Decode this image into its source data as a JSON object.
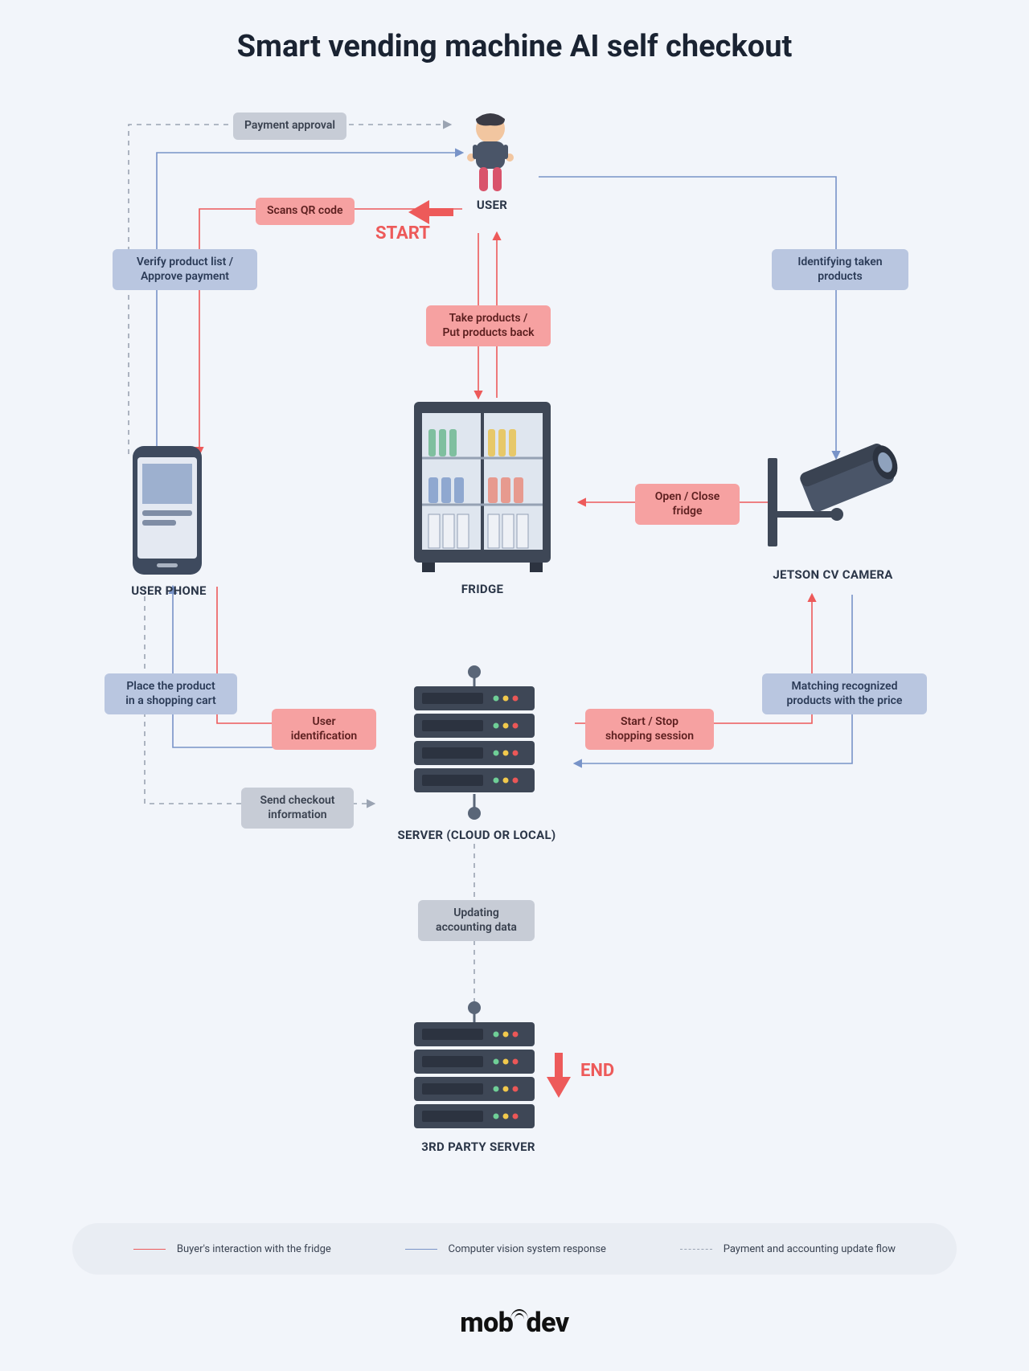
{
  "title": "Smart vending machine AI self checkout",
  "markers": {
    "start": "START",
    "end": "END"
  },
  "nodes": {
    "user": "USER",
    "phone": "USER PHONE",
    "fridge": "FRIDGE",
    "camera": "JETSON CV CAMERA",
    "server": "SERVER (CLOUD OR LOCAL)",
    "third_party": "3RD PARTY SERVER"
  },
  "edges": {
    "payment_approval": "Payment approval",
    "scans_qr": "Scans QR code",
    "verify_approve": "Verify product list /\nApprove payment",
    "identifying": "Identifying taken\nproducts",
    "take_put": "Take products /\nPut products back",
    "open_close": "Open / Close\nfridge",
    "place_cart": "Place the product\nin a shopping cart",
    "user_ident": "User\nidentification",
    "start_stop": "Start / Stop\nshopping session",
    "matching": "Matching recognized\nproducts with the price",
    "send_checkout": "Send checkout\ninformation",
    "updating": "Updating\naccounting data"
  },
  "legend": {
    "red": "Buyer's interaction with the fridge",
    "blue": "Computer vision system response",
    "gray": "Payment and accounting update flow"
  },
  "brand": "mobidev",
  "colors": {
    "red": "#ed5a5a",
    "blue": "#7893c8",
    "gray": "#9aa3b2"
  }
}
